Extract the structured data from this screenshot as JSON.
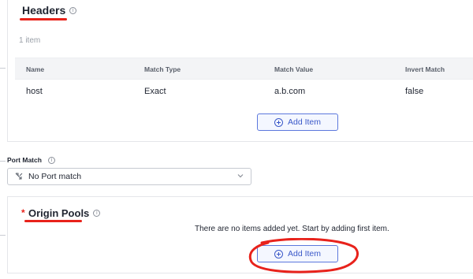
{
  "headers_section": {
    "title": "Headers",
    "info_glyph": "i",
    "item_count": "1 item",
    "columns": [
      "Name",
      "Match Type",
      "Match Value",
      "Invert Match"
    ],
    "rows": [
      [
        "host",
        "Exact",
        "a.b.com",
        "false"
      ]
    ],
    "add_button_label": "Add Item"
  },
  "port_match": {
    "label": "Port Match",
    "info_glyph": "i",
    "selected_value": "No Port match"
  },
  "origin_pools": {
    "required_marker": "*",
    "title": "Origin Pools",
    "info_glyph": "i",
    "empty_message": "There are no items added yet. Start by adding first item.",
    "add_button_label": "Add Item"
  },
  "annotation_colors": {
    "highlight": "#e8221b",
    "accent": "#3b59c9"
  }
}
